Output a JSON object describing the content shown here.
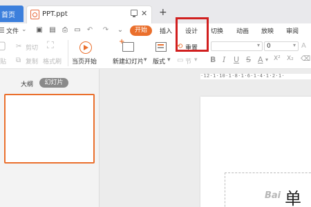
{
  "tabs": {
    "home": "首页",
    "file": "PPT.ppt",
    "close": "✕",
    "new": "+"
  },
  "menu": {
    "file": "文件",
    "start": "开始",
    "insert": "插入",
    "design": "设计",
    "transition": "切换",
    "animation": "动画",
    "slideshow": "放映",
    "review": "审阅",
    "undo": "↶",
    "redo": "↷"
  },
  "toolbar": {
    "paste": "贴",
    "cut": "剪切",
    "copy": "复制",
    "format_painter": "格式刷",
    "from_current": "当页开始",
    "new_slide": "新建幻灯片",
    "layout": "版式",
    "section": "节",
    "reset": "重置",
    "font_size": "0",
    "bold": "B",
    "italic": "I",
    "underline": "U",
    "strike": "S",
    "font_color": "A",
    "superscript": "X²",
    "subscript": "X₂"
  },
  "panel": {
    "outline": "大纲",
    "slides": "幻灯片"
  },
  "ruler": {
    "text": "·12·1·10·1·8·1·6·1·4·1·2·1·"
  },
  "slide": {
    "text": "单"
  },
  "watermark": {
    "text": "Bai"
  },
  "colors": {
    "accent": "#ea6f2c",
    "home_tab": "#3c7fdc",
    "highlight": "#d11f1f"
  }
}
